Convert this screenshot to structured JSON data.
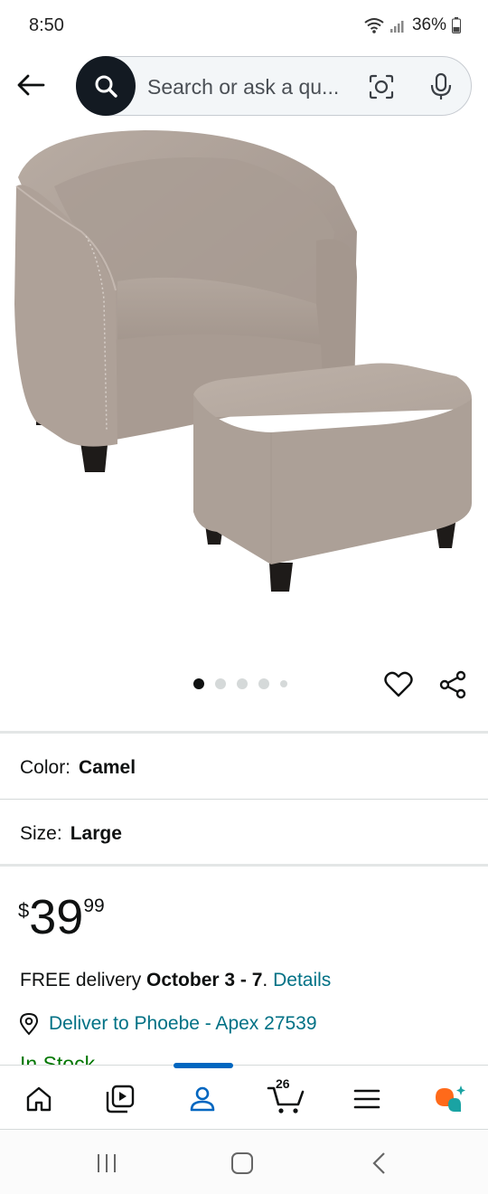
{
  "status_bar": {
    "time": "8:50",
    "battery": "36%",
    "icons": [
      "wifi-icon",
      "signal-icon",
      "battery-icon"
    ]
  },
  "search": {
    "placeholder": "Search or ask a qu..."
  },
  "product": {
    "image_alt": "Tub chair slipcover with ottoman cover",
    "image_count": 5,
    "active_image_index": 0
  },
  "variations": {
    "color_label": "Color:",
    "color_value": "Camel",
    "size_label": "Size:",
    "size_value": "Large"
  },
  "price": {
    "symbol": "$",
    "whole": "39",
    "fraction": "99"
  },
  "delivery": {
    "prefix": "FREE delivery ",
    "date": "October 3 - 7",
    "separator": ". ",
    "details_link": "Details",
    "deliver_to": "Deliver to Phoebe - Apex 27539",
    "stock": "In Stock"
  },
  "bottom_nav": {
    "items": [
      "home-icon",
      "video-icon",
      "account-icon",
      "cart-icon",
      "menu-icon",
      "rufus-icon"
    ],
    "active_index": 2,
    "cart_count": "26"
  },
  "colors": {
    "link": "#007185",
    "accent": "#0066c0",
    "search_button": "#131a22",
    "in_stock": "#007600",
    "rufus_orange": "#ff6a1a",
    "rufus_teal": "#1aa3a3"
  }
}
